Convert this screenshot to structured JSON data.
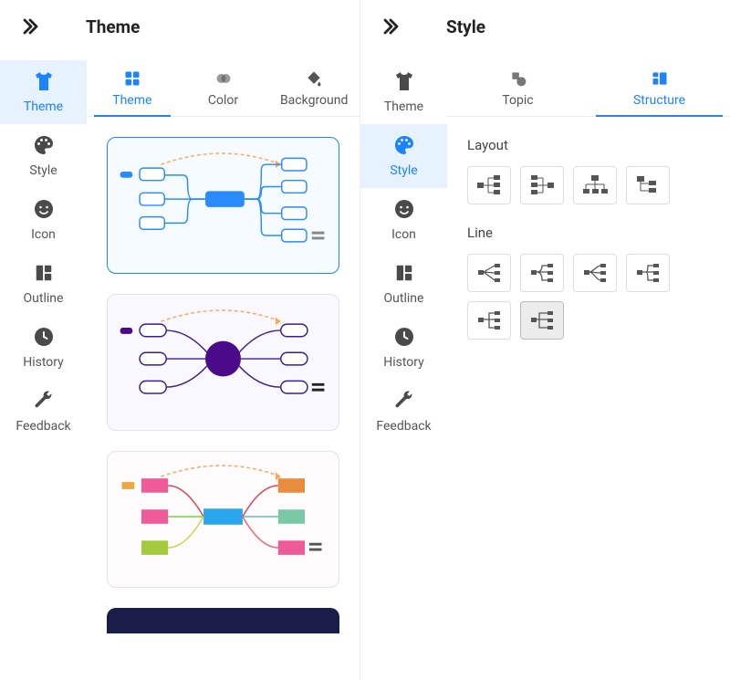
{
  "left": {
    "title": "Theme",
    "sidebar": [
      {
        "id": "theme",
        "label": "Theme",
        "active": true
      },
      {
        "id": "style",
        "label": "Style",
        "active": false
      },
      {
        "id": "icon",
        "label": "Icon",
        "active": false
      },
      {
        "id": "outline",
        "label": "Outline",
        "active": false
      },
      {
        "id": "history",
        "label": "History",
        "active": false
      },
      {
        "id": "feedback",
        "label": "Feedback",
        "active": false
      }
    ],
    "tabs": [
      {
        "id": "theme",
        "label": "Theme",
        "active": true
      },
      {
        "id": "color",
        "label": "Color",
        "active": false
      },
      {
        "id": "background",
        "label": "Background",
        "active": false
      }
    ]
  },
  "right": {
    "title": "Style",
    "sidebar": [
      {
        "id": "theme",
        "label": "Theme",
        "active": false
      },
      {
        "id": "style",
        "label": "Style",
        "active": true
      },
      {
        "id": "icon",
        "label": "Icon",
        "active": false
      },
      {
        "id": "outline",
        "label": "Outline",
        "active": false
      },
      {
        "id": "history",
        "label": "History",
        "active": false
      },
      {
        "id": "feedback",
        "label": "Feedback",
        "active": false
      }
    ],
    "tabs": [
      {
        "id": "topic",
        "label": "Topic",
        "active": false
      },
      {
        "id": "structure",
        "label": "Structure",
        "active": true
      }
    ],
    "sections": {
      "layout_label": "Layout",
      "line_label": "Line"
    }
  }
}
